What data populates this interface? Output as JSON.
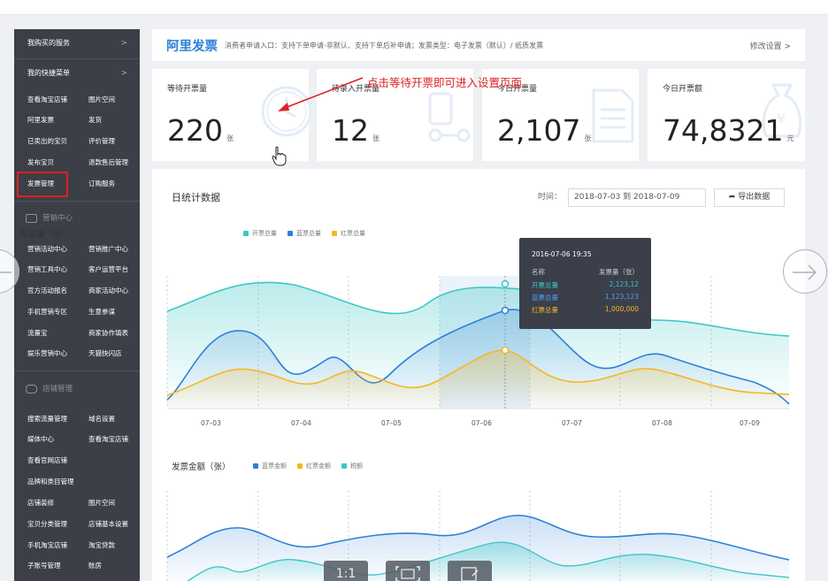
{
  "sidebar": {
    "heads": [
      {
        "label": "我购买的服务",
        "arrow": ">"
      },
      {
        "label": "我的快捷菜单",
        "arrow": ">"
      }
    ],
    "quick_links": [
      "查看淘宝店铺",
      "图片空间",
      "阿里发票",
      "发货",
      "已卖出的宝贝",
      "评价管理",
      "发布宝贝",
      "退款售后管理",
      "发票管理",
      "订购服务"
    ],
    "marketing_section": "营销中心",
    "marketing_links": [
      "营销活动中心",
      "营销推广中心",
      "营销工具中心",
      "客户运营平台",
      "官方活动报名",
      "商家活动中心",
      "手机营销专区",
      "生意参谋",
      "流量宝",
      "商家协作填表",
      "娱乐营销中心",
      "天猫快闪店"
    ],
    "shop_section": "店铺管理",
    "shop_links": [
      "搜索流量管理",
      "域名设置",
      "媒体中心",
      "查看淘宝店铺",
      "查看官网店铺",
      "",
      "品牌和类目管理",
      "",
      "店铺装修",
      "图片空间",
      "宝贝分类管理",
      "店铺基本设置",
      "手机淘宝店铺",
      "淘宝贷款",
      "子账号管理",
      "账房"
    ]
  },
  "header": {
    "title": "阿里发票",
    "desc": "消费者申请入口：支持下单申请-非默认、支持下单后补申请；发票类型：电子发票（默认）/ 纸质发票",
    "settings": "修改设置 >"
  },
  "cards": [
    {
      "label": "等待开票量",
      "value": "220",
      "unit": "张"
    },
    {
      "label": "待录入开票量",
      "value": "12",
      "unit": "张"
    },
    {
      "label": "今日开票量",
      "value": "2,107",
      "unit": "张"
    },
    {
      "label": "今日开票额",
      "value": "74,8321",
      "unit": "元"
    }
  ],
  "annotation": "点击等待开票即可进入设置页面",
  "panel": {
    "title": "日统计数据",
    "time_label": "时间：",
    "date_range": "2018-07-03 到 2018-07-09",
    "export": "导出数据"
  },
  "chart_data": [
    {
      "type": "area",
      "title": "发票量（张）",
      "x": [
        "07–03",
        "07–04",
        "07–05",
        "07–06",
        "07–07",
        "07–08",
        "07–09"
      ],
      "series": [
        {
          "name": "开票总量",
          "color": "#3ec7c7"
        },
        {
          "name": "蓝票总量",
          "color": "#2f7fd8"
        },
        {
          "name": "红票总量",
          "color": "#f5b723"
        }
      ],
      "tooltip": {
        "time": "2016-07-06  19:35",
        "col1": "名称",
        "col2": "发票量（张）",
        "rows": [
          {
            "name": "开票总量",
            "value": "2,123,12",
            "color": "#3ec7c7"
          },
          {
            "name": "蓝票总量",
            "value": "1,123,123",
            "color": "#4ea0f0"
          },
          {
            "name": "红票总量",
            "value": "1,000,000",
            "color": "#f5b723"
          }
        ]
      }
    },
    {
      "type": "area",
      "title": "发票金额（张）",
      "series": [
        {
          "name": "蓝票金额",
          "color": "#2f7fd8"
        },
        {
          "name": "红票金额",
          "color": "#f5b723"
        },
        {
          "name": "税额",
          "color": "#3ec7c7"
        }
      ]
    }
  ],
  "viewer_tools": [
    "1:1",
    "",
    ""
  ]
}
